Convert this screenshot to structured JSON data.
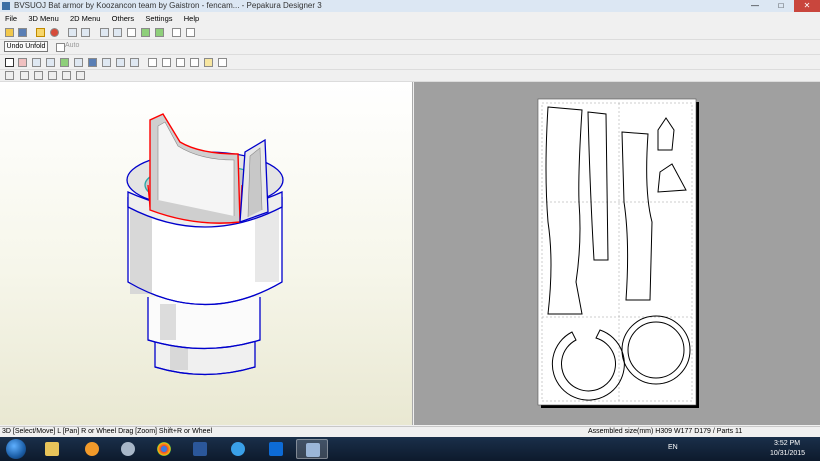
{
  "window": {
    "title": "BVSUOJ Bat armor by Koozancon team by Gaistron - fencam... - Pepakura Designer 3"
  },
  "menu": {
    "items": [
      "File",
      "3D Menu",
      "2D Menu",
      "Others",
      "Settings",
      "Help"
    ]
  },
  "toolbar": {
    "undo_label": "Undo Unfold",
    "auto_label": "Auto"
  },
  "status": {
    "left": "3D [Select/Move] L [Pan] R or Wheel Drag [Zoom] Shift+R or Wheel",
    "right": "Assembled size(mm) H309 W177 D179 / Parts 11"
  },
  "tray": {
    "lang": "EN",
    "time": "3:52 PM",
    "date": "10/31/2015"
  },
  "colors": {
    "accent": "#3a6ea5",
    "view2d_bg": "#a0a0a0",
    "cut_line": "#ff0000",
    "edge_line": "#0000cc"
  },
  "taskbar_items": [
    "explorer-icon",
    "media-player-icon",
    "chrome-icon",
    "word-icon",
    "internet-explorer-icon",
    "dropbox-icon",
    "pepakura-icon"
  ]
}
